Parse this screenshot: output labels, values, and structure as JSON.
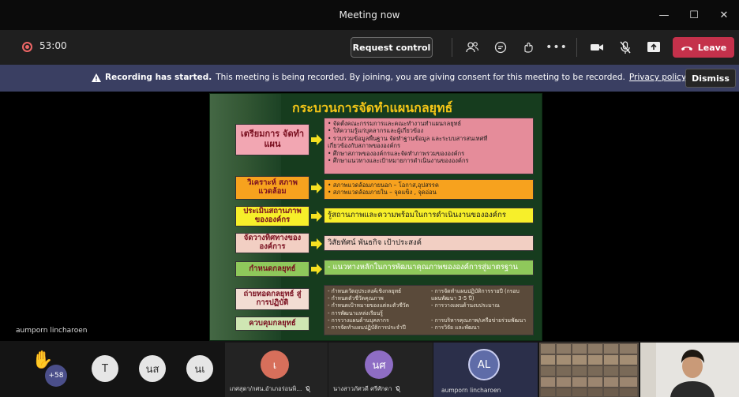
{
  "window": {
    "title": "Meeting now"
  },
  "toolbar": {
    "timer": "53:00",
    "request_control_label": "Request control",
    "leave_label": "Leave"
  },
  "banner": {
    "bold_text": "Recording has started.",
    "text": "This meeting is being recorded. By joining, you are giving consent for this meeting to be recorded.",
    "link": "Privacy policy",
    "dismiss_label": "Dismiss"
  },
  "stage": {
    "presenter_name": "aumporn lincharoen"
  },
  "slide": {
    "title": "กระบวนการจัดทำแผนกลยุทธ์",
    "steps": [
      {
        "label": "เตรียมการ จัดทำแผน",
        "lines": [
          "• จัดตั้งคณะกรรมการและคณะทำงานทำแผนกลยุทธ์",
          "• ให้ความรู้แก่บุคลากรและผู้เกี่ยวข้อง",
          "• รวบรวมข้อมูลพื้นฐาน จัดทำฐานข้อมูล และระบบสารสนเทศที่",
          "เกี่ยวข้องกับสภาพขององค์กร",
          "• ศึกษาสภาพขององค์กรและจัดทำภาพรวมขององค์กร",
          "• ศึกษาแนวทางและเป้าหมายการดำเนินงานขององค์กร"
        ]
      },
      {
        "label": "วิเคราะห์ สภาพแวดล้อม",
        "lines": [
          "• สภาพแวดล้อมภายนอก – โอกาส,อุปสรรค",
          "• สภาพแวดล้อมภายใน – จุดแข็ง , จุดอ่อน"
        ]
      },
      {
        "label": "ประเมินสถานภาพ ขององค์กร",
        "lines": [
          "รู้สถานภาพและความพร้อมในการดำเนินงานขององค์กร"
        ]
      },
      {
        "label": "จัดวางทิศทางของ องค์การ",
        "lines": [
          "วิสัยทัศน์ พันธกิจ  เป้าประสงค์"
        ]
      },
      {
        "label": "กำหนดกลยุทธ์",
        "lines": [
          "- แนวทางหลักในการพัฒนาคุณภาพขององค์การสู่มาตรฐาน"
        ]
      },
      {
        "label": "ถ่ายทอดกลยุทธ์ สู่การปฏิบัติ",
        "lines": []
      },
      {
        "label": "ควบคุมกลยุทธ์",
        "lines": []
      }
    ],
    "implementation": {
      "left": [
        "- กำหนดวัตถุประสงค์เชิงกลยุทธ์",
        "- กำหนดตัวชี้วัดคุณภาพ",
        "- กำหนดเป้าหมายของแต่ละตัวชี้วัด",
        "- การพัฒนาแหล่งเรียนรู้",
        "- การวางแผนด้านบุคลากร",
        "- การจัดทำแผนปฏิบัติการประจำปี"
      ],
      "right": [
        "- การจัดทำแผนปฏิบัติการรายปี (กรอบ",
        "  แผนพัฒนา 3-5  ปี)",
        "- การวางแผนด้านงบประมาณ",
        "",
        "- การบริหารคุณภาพ/เครือข่ายร่วมพัฒนา",
        "- การวิจัย และพัฒนา"
      ]
    }
  },
  "participants": {
    "overflow_count": "+58",
    "avatars": [
      {
        "initials": "T",
        "color": "#e6e6e6"
      },
      {
        "initials": "นส",
        "color": "#e6e6e6"
      },
      {
        "initials": "นเ",
        "color": "#e6e6e6"
      }
    ],
    "tiles": [
      {
        "initials": "เ",
        "label": "เกศสุดา/กศน.อำเภอร่อนพิ...",
        "avatar_color": "#d76f5b"
      },
      {
        "initials": "นศ",
        "label": "นางสาวภัศวดี ศรีศักดา",
        "avatar_color": "#8e6dc4"
      },
      {
        "initials": "AL",
        "label": "aumporn lincharoen",
        "avatar_color": "#5f6ca8"
      }
    ]
  },
  "colors": {
    "leave": "#c4314b",
    "banner": "#3a3f62",
    "slide_bg": "#163c1e",
    "title_yellow": "#f5c617"
  }
}
